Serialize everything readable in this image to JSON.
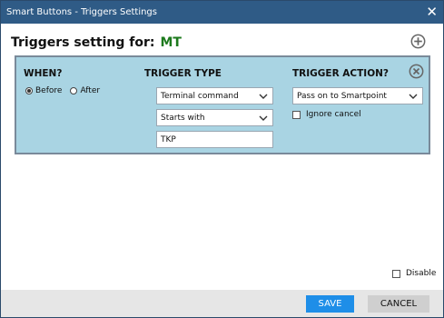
{
  "window": {
    "title": "Smart Buttons - Triggers Settings",
    "close_glyph": "✕"
  },
  "header": {
    "label": "Triggers setting for:",
    "value": "MT"
  },
  "trigger": {
    "when_label": "WHEN?",
    "type_label": "TRIGGER TYPE",
    "action_label": "TRIGGER ACTION?",
    "when_options": [
      {
        "label": "Before",
        "selected": true
      },
      {
        "label": "After",
        "selected": false
      }
    ],
    "type_select": "Terminal command",
    "match_select": "Starts with",
    "text_value": "TKP",
    "action_select": "Pass on to Smartpoint",
    "ignore_cancel_label": "Ignore cancel",
    "ignore_cancel_checked": false
  },
  "disable": {
    "label": "Disable",
    "checked": false
  },
  "footer": {
    "save_label": "SAVE",
    "cancel_label": "CANCEL"
  },
  "colors": {
    "titlebar": "#2f5b86",
    "panel": "#a9d4e3",
    "save": "#1e8ee8",
    "header_value": "#1d7a1d"
  }
}
